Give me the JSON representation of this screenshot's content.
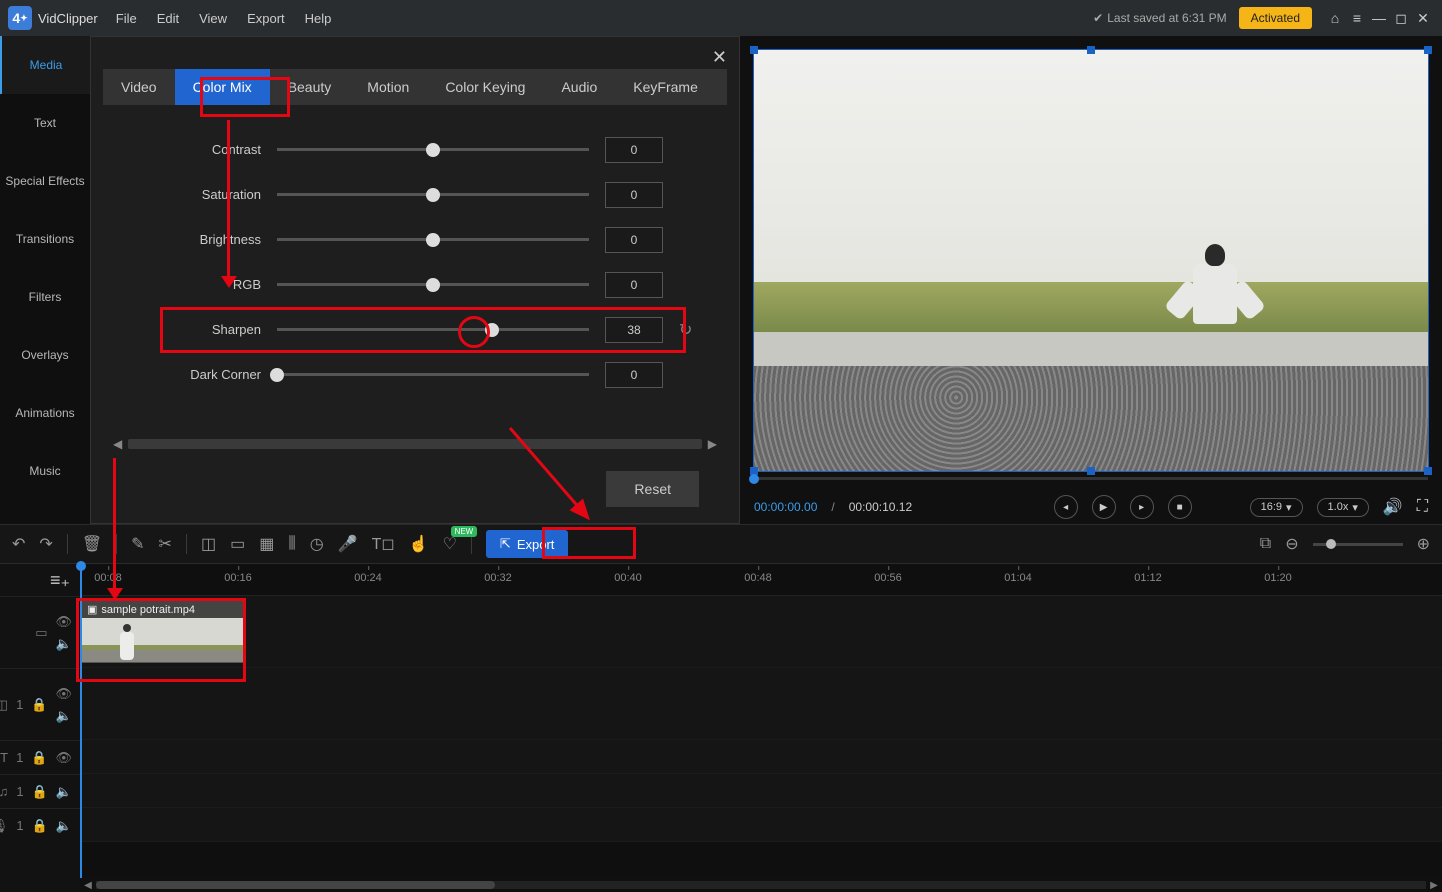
{
  "app": {
    "name": "VidClipper"
  },
  "menus": [
    "File",
    "Edit",
    "View",
    "Export",
    "Help"
  ],
  "titlebar": {
    "last_saved": "Last saved at 6:31 PM",
    "activated": "Activated"
  },
  "sidebar": {
    "items": [
      {
        "label": "Media"
      },
      {
        "label": "Text"
      },
      {
        "label": "Special Effects"
      },
      {
        "label": "Transitions"
      },
      {
        "label": "Filters"
      },
      {
        "label": "Overlays"
      },
      {
        "label": "Animations"
      },
      {
        "label": "Music"
      }
    ]
  },
  "props": {
    "tabs": [
      "Video",
      "Color Mix",
      "Beauty",
      "Motion",
      "Color Keying",
      "Audio",
      "KeyFrame"
    ],
    "active_tab": 1,
    "sliders": {
      "contrast": {
        "label": "Contrast",
        "value": "0",
        "pos": 50
      },
      "saturation": {
        "label": "Saturation",
        "value": "0",
        "pos": 50
      },
      "brightness": {
        "label": "Brightness",
        "value": "0",
        "pos": 50
      },
      "rgb": {
        "label": "RGB",
        "value": "0",
        "pos": 50
      },
      "sharpen": {
        "label": "Sharpen",
        "value": "38",
        "pos": 69
      },
      "darkcorner": {
        "label": "Dark Corner",
        "value": "0",
        "pos": 0
      }
    },
    "reset_label": "Reset"
  },
  "preview": {
    "time_current": "00:00:00.00",
    "time_total": "00:00:10.12",
    "aspect": "16:9",
    "speed": "1.0x"
  },
  "toolbar": {
    "export_label": "Export",
    "new_badge": "NEW"
  },
  "timeline": {
    "ruler": [
      "00:08",
      "00:16",
      "00:24",
      "00:32",
      "00:40",
      "00:48",
      "00:56",
      "01:04",
      "01:12",
      "01:20"
    ],
    "clip": {
      "filename": "sample potrait.mp4"
    },
    "track2_count": "1",
    "track3_count": "1",
    "track4_count": "1",
    "track5_count": "1"
  }
}
